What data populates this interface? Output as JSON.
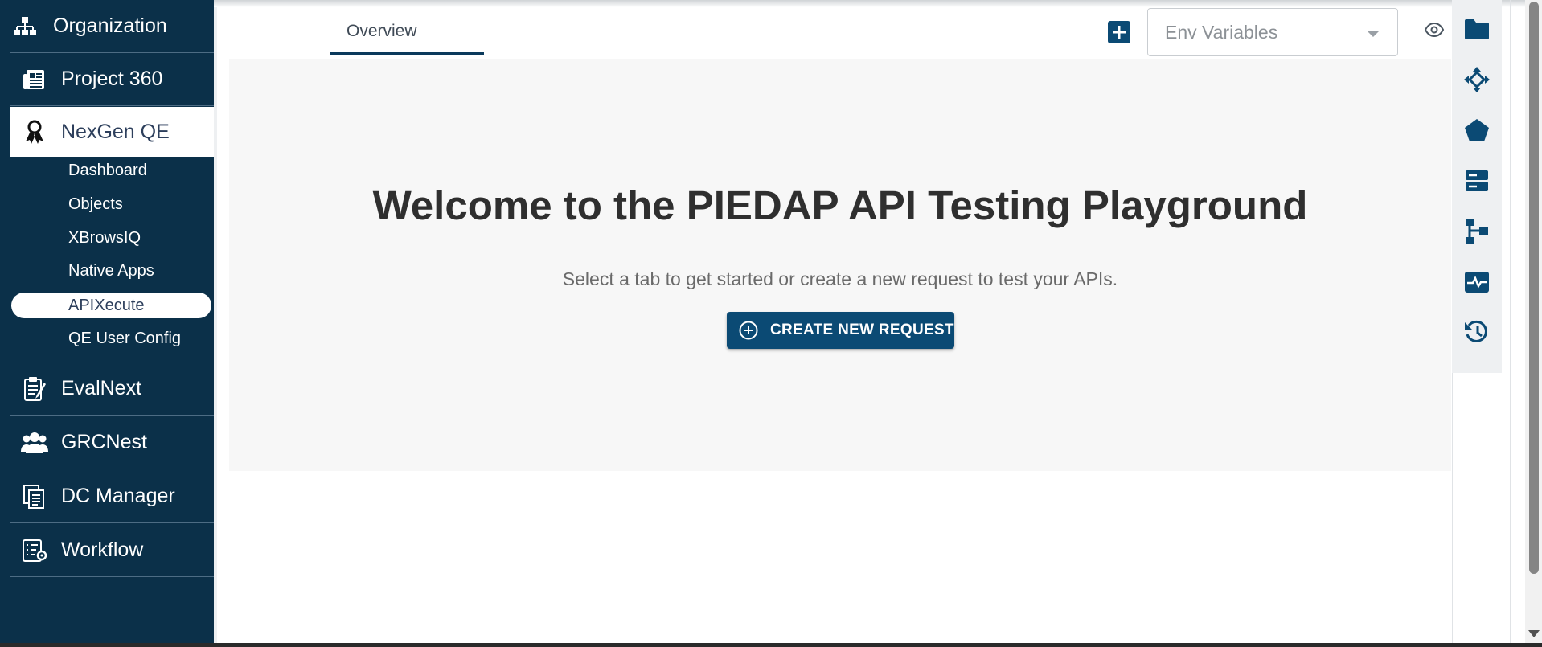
{
  "sidebar": {
    "items": [
      {
        "label": "Organization",
        "icon": "sitemap-icon"
      },
      {
        "label": "Project 360",
        "icon": "newspaper-icon"
      },
      {
        "label": "NexGen QE",
        "icon": "award-icon",
        "active": true
      },
      {
        "label": "EvalNext",
        "icon": "clipboard-icon"
      },
      {
        "label": "GRCNest",
        "icon": "users-icon"
      },
      {
        "label": "DC Manager",
        "icon": "documents-icon"
      },
      {
        "label": "Workflow",
        "icon": "list-settings-icon"
      }
    ],
    "subitems": [
      {
        "label": "Dashboard"
      },
      {
        "label": "Objects"
      },
      {
        "label": "XBrowsIQ"
      },
      {
        "label": "Native Apps"
      },
      {
        "label": "APIXecute",
        "active": true
      },
      {
        "label": "QE User Config"
      }
    ]
  },
  "header": {
    "tab_label": "Overview",
    "env_placeholder": "Env Variables"
  },
  "welcome": {
    "title": "Welcome to the PIEDAP API Testing Playground",
    "subtitle": "Select a tab to get started or create a new request to test your APIs.",
    "create_button": "CREATE NEW REQUEST"
  },
  "right_toolbar": [
    "folder-icon",
    "move-icon",
    "pentagon-icon",
    "server-icon",
    "hierarchy-icon",
    "activity-icon",
    "history-icon"
  ],
  "colors": {
    "sidebar_bg": "#0b3049",
    "accent": "#0b4a74",
    "panel_bg": "#f7f7f7"
  }
}
